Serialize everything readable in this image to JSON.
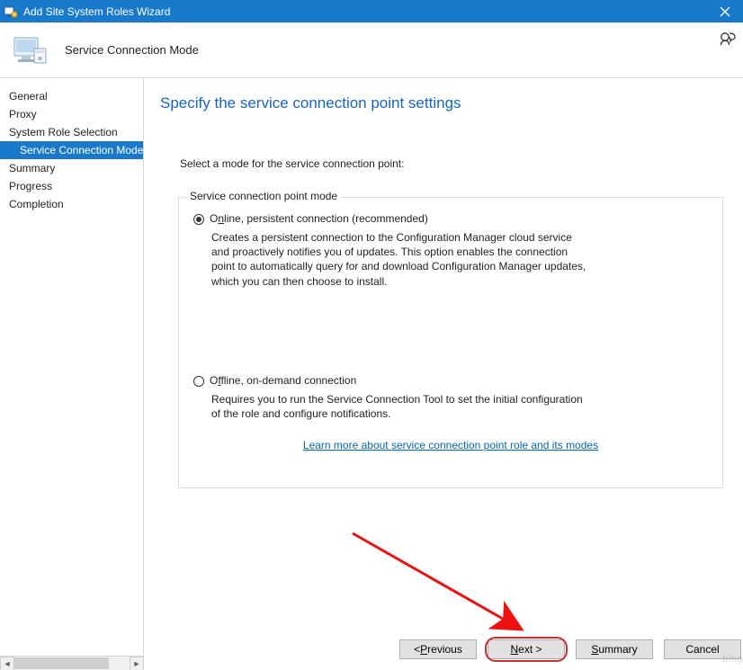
{
  "titlebar": {
    "title": "Add Site System Roles Wizard"
  },
  "header": {
    "subtitle": "Service Connection Mode"
  },
  "sidebar": {
    "items": [
      {
        "label": "General",
        "indent": false,
        "selected": false
      },
      {
        "label": "Proxy",
        "indent": false,
        "selected": false
      },
      {
        "label": "System Role Selection",
        "indent": false,
        "selected": false
      },
      {
        "label": "Service Connection Mode",
        "indent": true,
        "selected": true
      },
      {
        "label": "Summary",
        "indent": false,
        "selected": false
      },
      {
        "label": "Progress",
        "indent": false,
        "selected": false
      },
      {
        "label": "Completion",
        "indent": false,
        "selected": false
      }
    ]
  },
  "main": {
    "heading": "Specify the service connection point settings",
    "prompt": "Select a mode for the service connection point:",
    "group_legend": "Service connection point mode",
    "option_online": {
      "label_pre": "O",
      "label_mn": "n",
      "label_post": "line, persistent connection (recommended)",
      "desc": "Creates a persistent connection to the Configuration Manager cloud service and proactively notifies you of updates. This option enables the connection point to automatically query for and download Configuration Manager updates, which you can then choose to install."
    },
    "option_offline": {
      "label_pre": "O",
      "label_mn": "f",
      "label_post": "fline, on-demand connection",
      "desc": "Requires you to run the Service Connection Tool to set the initial configuration of the role and configure notifications."
    },
    "link": "Learn more about service connection point role and its modes"
  },
  "footer": {
    "previous_pre": "< ",
    "previous_mn": "P",
    "previous_post": "revious",
    "next_mn": "N",
    "next_post": "ext >",
    "summary_mn": "S",
    "summary_post": "ummary",
    "cancel": "Cancel"
  }
}
